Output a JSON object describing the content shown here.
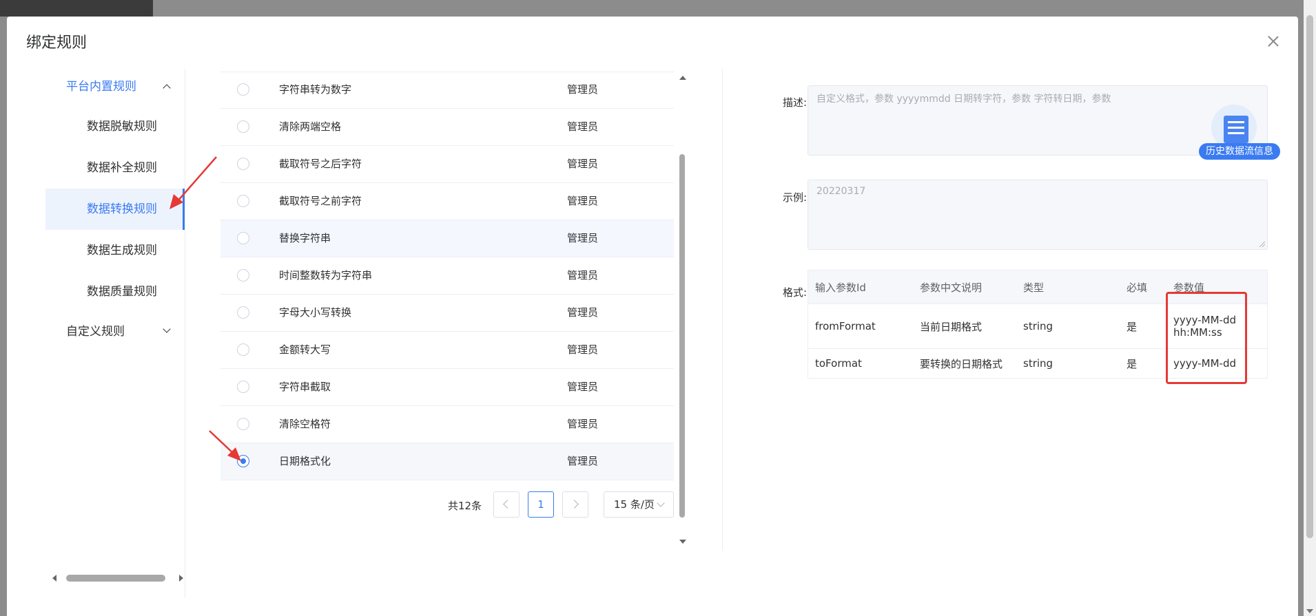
{
  "dialog": {
    "title": "绑定规则"
  },
  "menu": {
    "groups": [
      {
        "label": "平台内置规则",
        "open": true
      },
      {
        "label": "自定义规则",
        "open": false
      }
    ],
    "items": [
      "数据脱敏规则",
      "数据补全规则",
      "数据转换规则",
      "数据生成规则",
      "数据质量规则"
    ],
    "active_item": "数据转换规则"
  },
  "rules": [
    {
      "name": "字符串转为数字",
      "owner": "管理员",
      "selected": false
    },
    {
      "name": "清除两端空格",
      "owner": "管理员",
      "selected": false
    },
    {
      "name": "截取符号之后字符",
      "owner": "管理员",
      "selected": false
    },
    {
      "name": "截取符号之前字符",
      "owner": "管理员",
      "selected": false
    },
    {
      "name": "替换字符串",
      "owner": "管理员",
      "selected": false
    },
    {
      "name": "时间整数转为字符串",
      "owner": "管理员",
      "selected": false
    },
    {
      "name": "字母大小写转换",
      "owner": "管理员",
      "selected": false
    },
    {
      "name": "金额转大写",
      "owner": "管理员",
      "selected": false
    },
    {
      "name": "字符串截取",
      "owner": "管理员",
      "selected": false
    },
    {
      "name": "清除空格符",
      "owner": "管理员",
      "selected": false
    },
    {
      "name": "日期格式化",
      "owner": "管理员",
      "selected": true
    }
  ],
  "pagination": {
    "total": "共12条",
    "current_page": "1",
    "page_size": "15 条/页"
  },
  "detail": {
    "description_label": "描述:",
    "description_text": "自定义格式，参数 yyyymmdd 日期转字符，参数 字符转日期，参数",
    "example_label": "示例:",
    "example_text": "20220317",
    "format_label": "格式:",
    "history_button": "历史数据流信息",
    "format_table": {
      "headers": [
        "输入参数Id",
        "参数中文说明",
        "类型",
        "必填",
        "参数值"
      ],
      "rows": [
        {
          "id": "fromFormat",
          "desc": "当前日期格式",
          "type": "string",
          "required": "是",
          "value_line1": "yyyy-MM-dd",
          "value_line2": "hh:MM:ss"
        },
        {
          "id": "toFormat",
          "desc": "要转换的日期格式",
          "type": "string",
          "required": "是",
          "value_line1": "yyyy-MM-dd",
          "value_line2": ""
        }
      ]
    }
  },
  "colors": {
    "accent": "#3a7bf2",
    "annotation": "#e53935"
  },
  "icons": [
    "close-icon",
    "chevron-up-icon",
    "chevron-down-icon",
    "radio-icon",
    "chevron-left-icon",
    "chevron-right-icon",
    "document-icon",
    "arrow-annotation-icon"
  ]
}
